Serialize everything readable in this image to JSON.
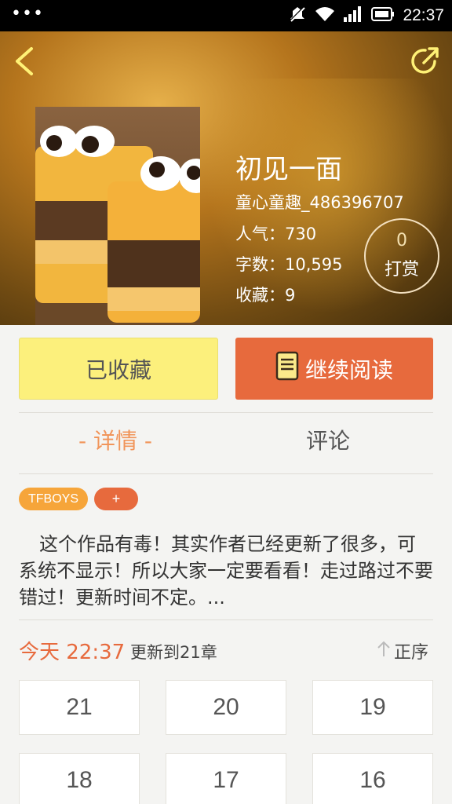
{
  "status_bar": {
    "dots": "•••",
    "time": "22:37"
  },
  "book": {
    "title": "初见一面",
    "author": "童心童趣_486396707",
    "popularity": "人气：730",
    "word_count": "字数：10,595",
    "favorites": "收藏：9"
  },
  "tip": {
    "count": "0",
    "label": "打赏"
  },
  "actions": {
    "collected_label": "已收藏",
    "continue_label": "继续阅读"
  },
  "tabs": {
    "details": "- 详情 -",
    "comments": "评论"
  },
  "tags": {
    "tfboys": "TFBOYS",
    "add": "+"
  },
  "intro": "这个作品有毒！其实作者已经更新了很多，可系统不显示！所以大家一定要看看！走过路过不要错过！更新时间不定。...",
  "update": {
    "time": "今天 22:37",
    "text": "更新到21章",
    "order_label": "正序"
  },
  "chapters": [
    "21",
    "20",
    "19",
    "18",
    "17",
    "16"
  ],
  "colors": {
    "accent": "#e76a3d",
    "collected_bg": "#fcf07c",
    "tag_orange": "#f6a53a",
    "tab_active": "#f1955a"
  },
  "icons": [
    "back-icon",
    "share-icon",
    "book-icon",
    "up-arrow-icon"
  ]
}
